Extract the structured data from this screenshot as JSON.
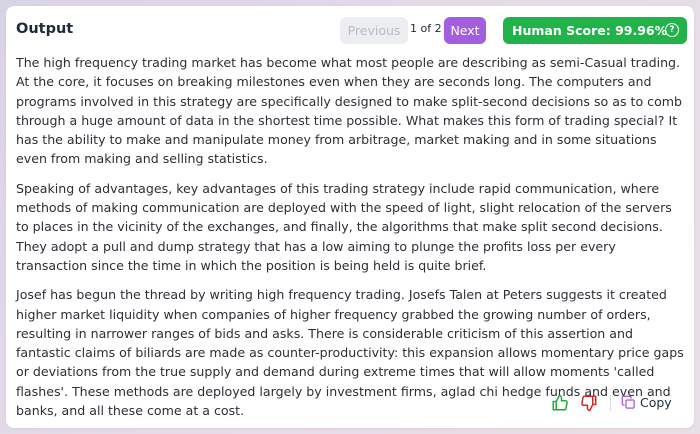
{
  "header": {
    "title": "Output",
    "previous_label": "Previous",
    "pager_text": "1 of 2",
    "next_label": "Next",
    "score_label": "Human Score: 99.96%",
    "info_icon_glyph": "?"
  },
  "content": {
    "paragraphs": [
      "The high frequency trading market has become what most people are describing as semi-Casual trading. At the core, it focuses on breaking milestones even when they are seconds long. The computers and programs involved in this strategy are specifically designed to make split-second decisions so as to comb through a huge amount of data in the shortest time possible. What makes this form of trading special? It has the ability to make and manipulate money from arbitrage, market making and in some situations even from making and selling statistics.",
      "Speaking of advantages, key advantages of this trading strategy include rapid communication, where methods of making communication are deployed with the speed of light, slight relocation of the servers to places in the vicinity of the exchanges, and finally, the algorithms that make split second decisions. They adopt a pull and dump strategy that has a low aiming to plunge the profits loss per every transaction since the time in which the position is being held is quite brief.",
      "Josef has begun the thread by writing high frequency trading. Josefs Talen at Peters suggests it created higher market liquidity when companies of higher frequency grabbed the growing number of orders, resulting in narrower ranges of bids and asks. There is considerable criticism of this assertion and fantastic claims of biliards are made as counter-productivity: this expansion allows momentary price gaps or deviations from the true supply and demand during extreme times that will allow moments 'called flashes'. These methods are deployed largely by investment firms, aglad chi hedge funds and even and banks, and all these come at a cost."
    ]
  },
  "footer": {
    "thumbs_up_icon": "thumbs-up-icon",
    "thumbs_down_icon": "thumbs-down-icon",
    "copy_icon": "copy-icon",
    "copy_label": "Copy"
  },
  "colors": {
    "next_bg": "#a35ee0",
    "score_bg": "#21b24a",
    "thumb_up": "#22a83a",
    "thumb_down": "#d22a2a",
    "copy_icon": "#9a5bd6"
  }
}
